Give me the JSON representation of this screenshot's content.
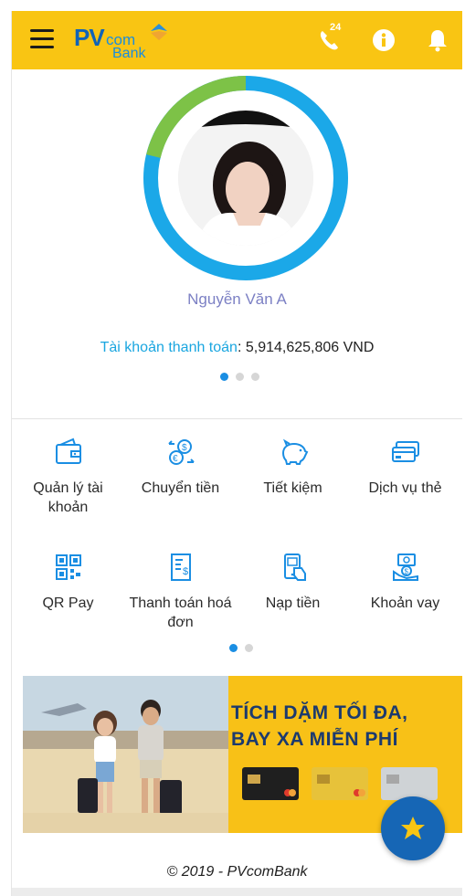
{
  "header": {
    "logo_pv": "PV",
    "logo_com": "com",
    "logo_bank": "Bank",
    "phone_badge": "24",
    "icons": [
      "menu-icon",
      "phone-24-icon",
      "info-icon",
      "bell-icon"
    ]
  },
  "profile": {
    "name": "Nguyễn Văn A",
    "balance_label": "Tài khoản thanh toán",
    "balance_value": ": 5,914,625,806 VND",
    "ring_colors": {
      "primary": "#1ba8e8",
      "secondary": "#7dc247"
    }
  },
  "menu": {
    "items": [
      {
        "label": "Quản lý tài khoản",
        "icon": "wallet-icon"
      },
      {
        "label": "Chuyển tiền",
        "icon": "currency-exchange-icon"
      },
      {
        "label": "Tiết kiệm",
        "icon": "piggy-bank-icon"
      },
      {
        "label": "Dịch vụ thẻ",
        "icon": "cards-icon"
      },
      {
        "label": "QR Pay",
        "icon": "qr-code-icon"
      },
      {
        "label": "Thanh toán hoá đơn",
        "icon": "bill-icon"
      },
      {
        "label": "Nạp tiền",
        "icon": "topup-phone-icon"
      },
      {
        "label": "Khoản vay",
        "icon": "loan-icon"
      }
    ]
  },
  "banner": {
    "line1": "TÍCH DẶM TỐI ĐA,",
    "line2": "BAY XA MIỄN PHÍ"
  },
  "footer": {
    "copyright": "© 2019 - PVcomBank"
  },
  "colors": {
    "header_bg": "#f9c513",
    "accent_blue": "#1a8ee3",
    "banner_bg": "#f8c117",
    "fab_bg": "#1666b5"
  }
}
